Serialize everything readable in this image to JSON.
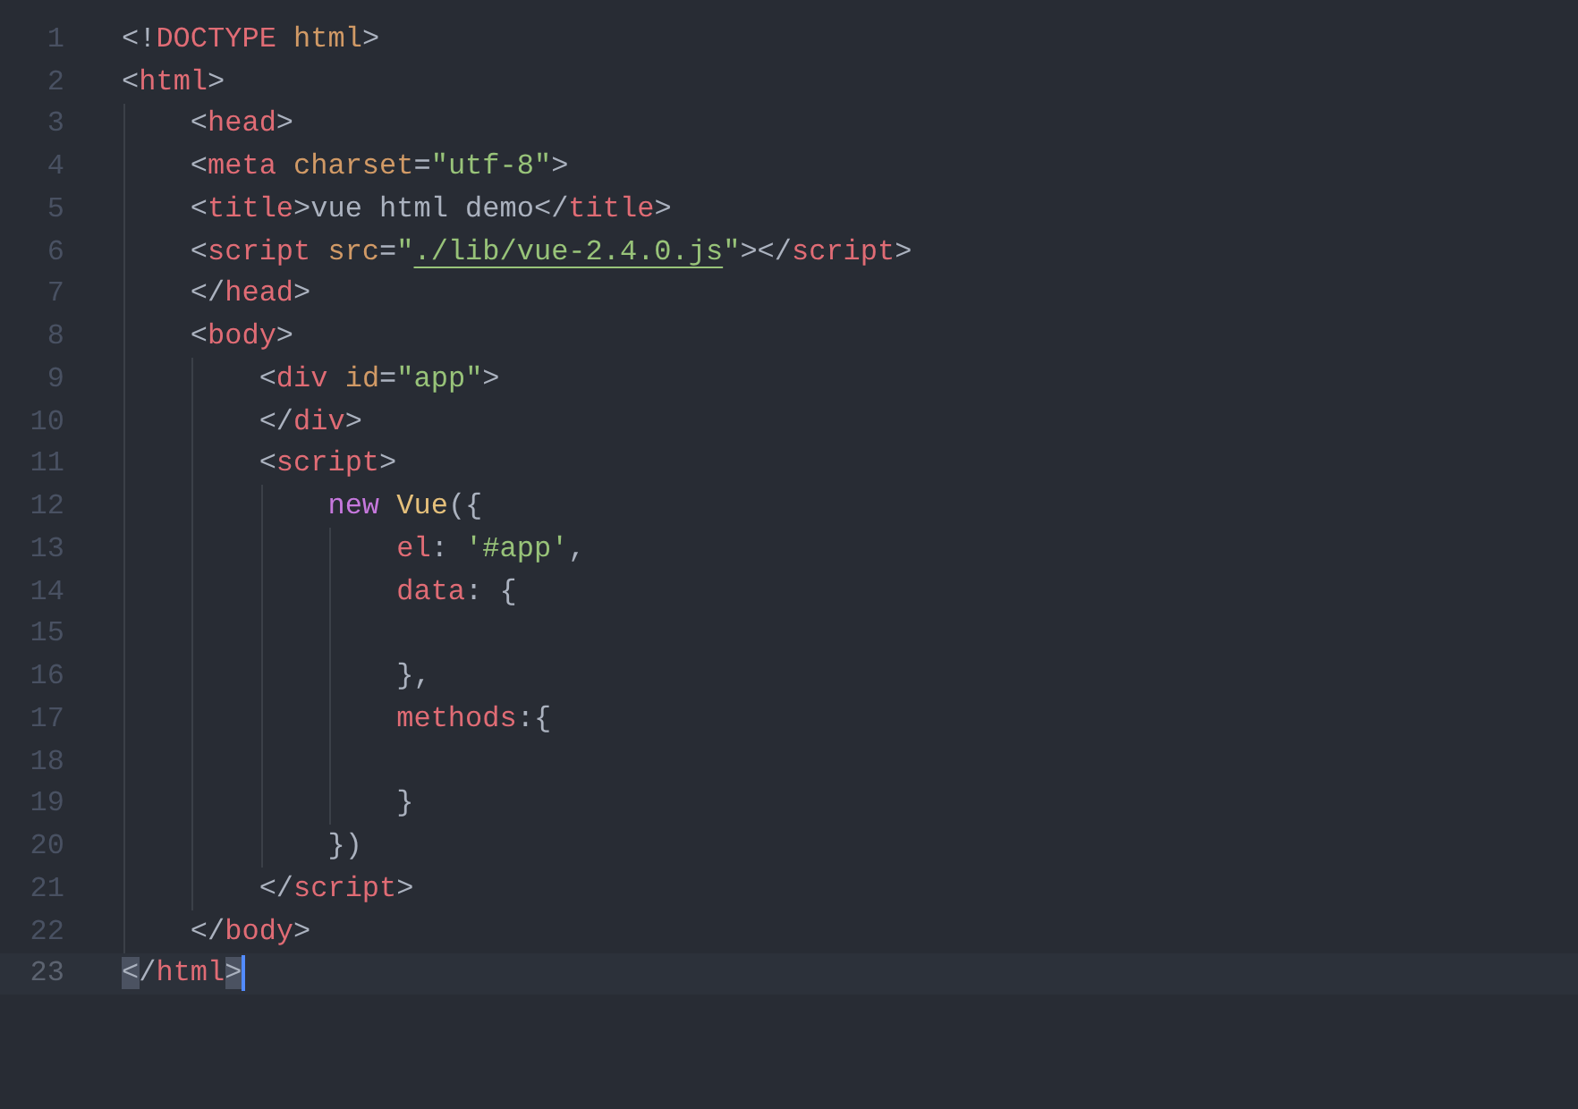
{
  "editor": {
    "lines": [
      {
        "number": "1",
        "current": false,
        "tokens": [
          {
            "kind": "punct",
            "text": "<!"
          },
          {
            "kind": "tag",
            "text": "DOCTYPE"
          },
          {
            "kind": "attr",
            "text": " html"
          },
          {
            "kind": "punct",
            "text": ">"
          }
        ]
      },
      {
        "number": "2",
        "current": false,
        "tokens": [
          {
            "kind": "punct",
            "text": "<"
          },
          {
            "kind": "tag",
            "text": "html"
          },
          {
            "kind": "punct",
            "text": ">"
          }
        ]
      },
      {
        "number": "3",
        "current": false,
        "tokens": [
          {
            "kind": "punct",
            "text": "    <"
          },
          {
            "kind": "tag",
            "text": "head"
          },
          {
            "kind": "punct",
            "text": ">"
          }
        ]
      },
      {
        "number": "4",
        "current": false,
        "tokens": [
          {
            "kind": "punct",
            "text": "    <"
          },
          {
            "kind": "tag",
            "text": "meta"
          },
          {
            "kind": "attr",
            "text": " charset"
          },
          {
            "kind": "punct",
            "text": "="
          },
          {
            "kind": "string",
            "text": "\"utf-8\""
          },
          {
            "kind": "punct",
            "text": ">"
          }
        ]
      },
      {
        "number": "5",
        "current": false,
        "tokens": [
          {
            "kind": "punct",
            "text": "    <"
          },
          {
            "kind": "tag",
            "text": "title"
          },
          {
            "kind": "punct",
            "text": ">"
          },
          {
            "kind": "text",
            "text": "vue html demo"
          },
          {
            "kind": "punct",
            "text": "</"
          },
          {
            "kind": "tag",
            "text": "title"
          },
          {
            "kind": "punct",
            "text": ">"
          }
        ]
      },
      {
        "number": "6",
        "current": false,
        "tokens": [
          {
            "kind": "punct",
            "text": "    <"
          },
          {
            "kind": "tag",
            "text": "script"
          },
          {
            "kind": "attr",
            "text": " src"
          },
          {
            "kind": "punct",
            "text": "="
          },
          {
            "kind": "string",
            "text": "\""
          },
          {
            "kind": "link",
            "text": "./lib/vue-2.4.0.js"
          },
          {
            "kind": "string",
            "text": "\""
          },
          {
            "kind": "punct",
            "text": "></"
          },
          {
            "kind": "tag",
            "text": "script"
          },
          {
            "kind": "punct",
            "text": ">"
          }
        ]
      },
      {
        "number": "7",
        "current": false,
        "tokens": [
          {
            "kind": "punct",
            "text": "    </"
          },
          {
            "kind": "tag",
            "text": "head"
          },
          {
            "kind": "punct",
            "text": ">"
          }
        ]
      },
      {
        "number": "8",
        "current": false,
        "tokens": [
          {
            "kind": "punct",
            "text": "    <"
          },
          {
            "kind": "tag",
            "text": "body"
          },
          {
            "kind": "punct",
            "text": ">"
          }
        ]
      },
      {
        "number": "9",
        "current": false,
        "tokens": [
          {
            "kind": "punct",
            "text": "        <"
          },
          {
            "kind": "tag",
            "text": "div"
          },
          {
            "kind": "attr",
            "text": " id"
          },
          {
            "kind": "punct",
            "text": "="
          },
          {
            "kind": "string",
            "text": "\"app\""
          },
          {
            "kind": "punct",
            "text": ">"
          }
        ]
      },
      {
        "number": "10",
        "current": false,
        "tokens": [
          {
            "kind": "punct",
            "text": "        </"
          },
          {
            "kind": "tag",
            "text": "div"
          },
          {
            "kind": "punct",
            "text": ">"
          }
        ]
      },
      {
        "number": "11",
        "current": false,
        "tokens": [
          {
            "kind": "punct",
            "text": "        <"
          },
          {
            "kind": "tag",
            "text": "script"
          },
          {
            "kind": "punct",
            "text": ">"
          }
        ]
      },
      {
        "number": "12",
        "current": false,
        "tokens": [
          {
            "kind": "keyword",
            "text": "            new"
          },
          {
            "kind": "func",
            "text": " Vue"
          },
          {
            "kind": "punct",
            "text": "({"
          }
        ]
      },
      {
        "number": "13",
        "current": false,
        "tokens": [
          {
            "kind": "prop",
            "text": "                el"
          },
          {
            "kind": "punct",
            "text": ": "
          },
          {
            "kind": "string",
            "text": "'#app'"
          },
          {
            "kind": "punct",
            "text": ","
          }
        ]
      },
      {
        "number": "14",
        "current": false,
        "tokens": [
          {
            "kind": "prop",
            "text": "                data"
          },
          {
            "kind": "punct",
            "text": ": {"
          }
        ]
      },
      {
        "number": "15",
        "current": false
      },
      {
        "number": "16",
        "current": false,
        "tokens": [
          {
            "kind": "punct",
            "text": "                },"
          }
        ]
      },
      {
        "number": "17",
        "current": false,
        "tokens": [
          {
            "kind": "prop",
            "text": "                methods"
          },
          {
            "kind": "punct",
            "text": ":{"
          }
        ]
      },
      {
        "number": "18",
        "current": false
      },
      {
        "number": "19",
        "current": false,
        "tokens": [
          {
            "kind": "punct",
            "text": "                }"
          }
        ]
      },
      {
        "number": "20",
        "current": false,
        "tokens": [
          {
            "kind": "punct",
            "text": "            })"
          }
        ]
      },
      {
        "number": "21",
        "current": false,
        "tokens": [
          {
            "kind": "punct",
            "text": "        </"
          },
          {
            "kind": "tag",
            "text": "script"
          },
          {
            "kind": "punct",
            "text": ">"
          }
        ]
      },
      {
        "number": "22",
        "current": false,
        "tokens": [
          {
            "kind": "punct",
            "text": "    </"
          },
          {
            "kind": "tag",
            "text": "body"
          },
          {
            "kind": "punct",
            "text": ">"
          }
        ]
      },
      {
        "number": "23",
        "current": true,
        "tokens": [
          {
            "kind": "punct",
            "text": "<",
            "bracket_match": true
          },
          {
            "kind": "punct",
            "text": "/"
          },
          {
            "kind": "tag",
            "text": "html"
          },
          {
            "kind": "punct",
            "text": ">",
            "bracket_match": true
          }
        ]
      }
    ]
  }
}
